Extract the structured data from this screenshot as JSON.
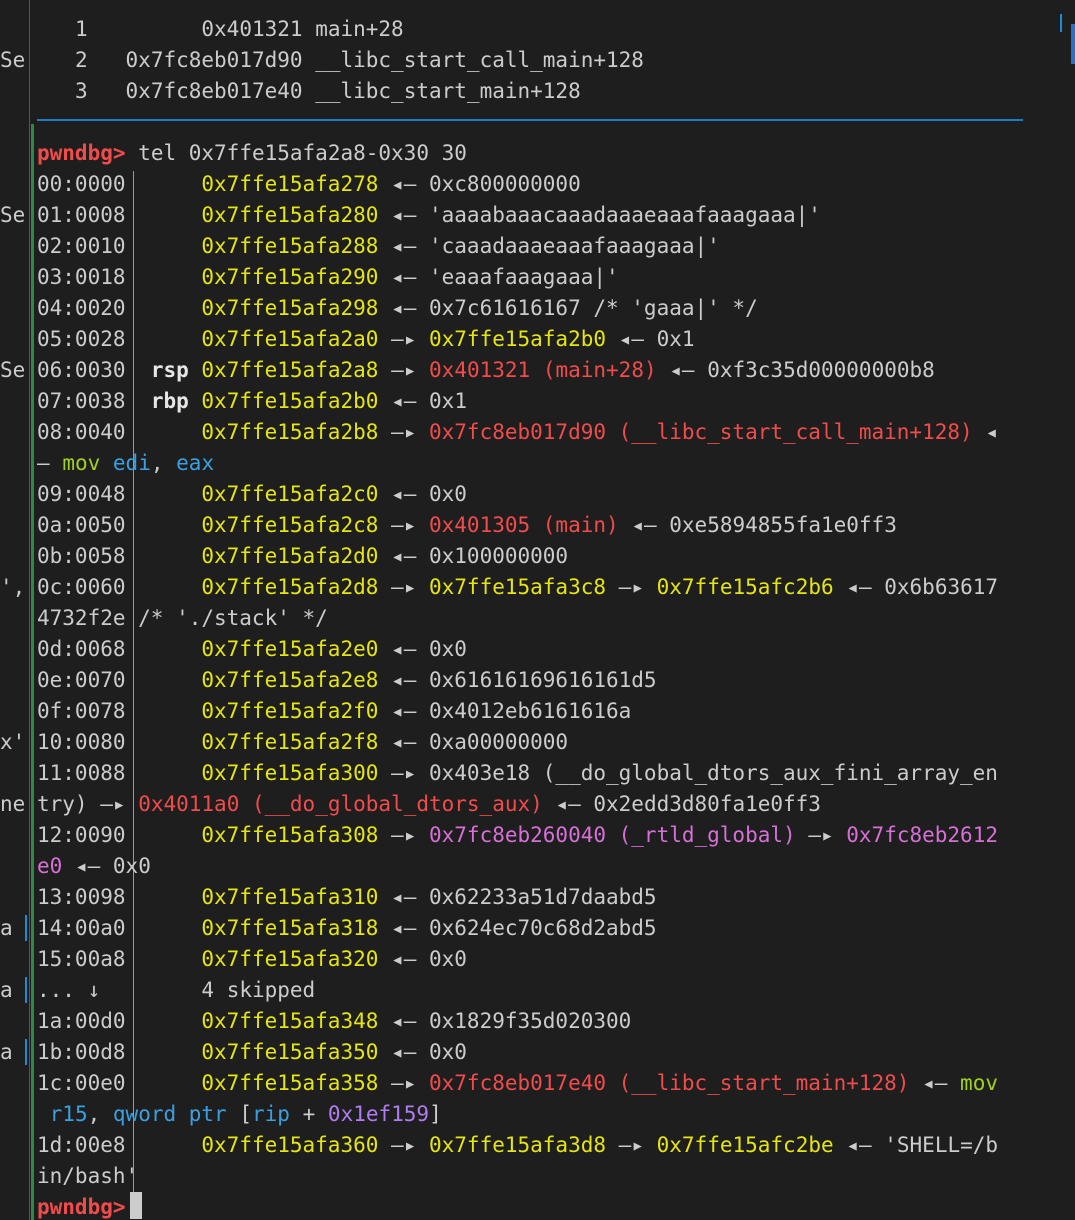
{
  "backtrace": [
    {
      "index": "1",
      "addr": "0x401321",
      "sym": "main+28"
    },
    {
      "index": "2",
      "addr": "0x7fc8eb017d90",
      "sym": "__libc_start_call_main+128"
    },
    {
      "index": "3",
      "addr": "0x7fc8eb017e40",
      "sym": "__libc_start_main+128"
    }
  ],
  "left_fragments": [
    "Se",
    "Se",
    "Se",
    "',",
    "x'",
    "ne",
    "a",
    "a",
    "a"
  ],
  "prompt": "pwndbg>",
  "command": "tel 0x7ffe15afa2a8-0x30 30",
  "arrows": {
    "left": "◂—",
    "right": "—▸",
    "skip_down": "↓"
  },
  "stack": {
    "r00": {
      "off": "00:0000",
      "addr": "0x7ffe15afa278",
      "val": "0xc800000000"
    },
    "r01": {
      "off": "01:0008",
      "addr": "0x7ffe15afa280",
      "val": "'aaaabaaacaaadaaaeaaafaaagaaa|'"
    },
    "r02": {
      "off": "02:0010",
      "addr": "0x7ffe15afa288",
      "val": "'caaadaaaeaaafaaagaaa|'"
    },
    "r03": {
      "off": "03:0018",
      "addr": "0x7ffe15afa290",
      "val": "'eaaafaaagaaa|'"
    },
    "r04": {
      "off": "04:0020",
      "addr": "0x7ffe15afa298",
      "val": "0x7c61616167 /* 'gaaa|' */"
    },
    "r05": {
      "off": "05:0028",
      "addr": "0x7ffe15afa2a0",
      "ptr": "0x7ffe15afa2b0",
      "val": "0x1"
    },
    "r06": {
      "off": "06:0030",
      "reg": "rsp",
      "addr": "0x7ffe15afa2a8",
      "ptr": "0x401321 (main+28)",
      "val": "0xf3c35d00000000b8"
    },
    "r07": {
      "off": "07:0038",
      "reg": "rbp",
      "addr": "0x7ffe15afa2b0",
      "val": "0x1"
    },
    "r08": {
      "off": "08:0040",
      "addr": "0x7ffe15afa2b8",
      "ptr": "0x7fc8eb017d90 (__libc_start_call_main+128)",
      "tail": "◂",
      "cont_dash": "—",
      "cont_op": "mov",
      "cont_a": "edi",
      "cont_comma": ",",
      "cont_b": "eax"
    },
    "r09": {
      "off": "09:0048",
      "addr": "0x7ffe15afa2c0",
      "val": "0x0"
    },
    "r0a": {
      "off": "0a:0050",
      "addr": "0x7ffe15afa2c8",
      "ptr": "0x401305 (main)",
      "val": "0xe5894855fa1e0ff3"
    },
    "r0b": {
      "off": "0b:0058",
      "addr": "0x7ffe15afa2d0",
      "val": "0x100000000"
    },
    "r0c": {
      "off": "0c:0060",
      "addr": "0x7ffe15afa2d8",
      "ptr1": "0x7ffe15afa3c8",
      "ptr2": "0x7ffe15afc2b6",
      "val": "0x6b63617",
      "cont": "4732f2e /* './stack' */"
    },
    "r0d": {
      "off": "0d:0068",
      "addr": "0x7ffe15afa2e0",
      "val": "0x0"
    },
    "r0e": {
      "off": "0e:0070",
      "addr": "0x7ffe15afa2e8",
      "val": "0x61616169616161d5"
    },
    "r0f": {
      "off": "0f:0078",
      "addr": "0x7ffe15afa2f0",
      "val": "0x4012eb6161616a"
    },
    "r10": {
      "off": "10:0080",
      "addr": "0x7ffe15afa2f8",
      "val": "0xa00000000"
    },
    "r11": {
      "off": "11:0088",
      "addr": "0x7ffe15afa300",
      "ptr": "0x403e18 (__do_global_dtors_aux_fini_array_en",
      "cont_a": "try)",
      "cont_ptr": "0x4011a0 (__do_global_dtors_aux)",
      "val": "0x2edd3d80fa1e0ff3"
    },
    "r12": {
      "off": "12:0090",
      "addr": "0x7ffe15afa308",
      "ptr1": "0x7fc8eb260040 (_rtld_global)",
      "ptr2": "0x7fc8eb2612",
      "cont_a": "e0",
      "val": "0x0"
    },
    "r13": {
      "off": "13:0098",
      "addr": "0x7ffe15afa310",
      "val": "0x62233a51d7daabd5"
    },
    "r14": {
      "off": "14:00a0",
      "addr": "0x7ffe15afa318",
      "val": "0x624ec70c68d2abd5"
    },
    "r15": {
      "off": "15:00a8",
      "addr": "0x7ffe15afa320",
      "val": "0x0"
    },
    "skip": {
      "dots": "...",
      "text": "4 skipped"
    },
    "r1a": {
      "off": "1a:00d0",
      "addr": "0x7ffe15afa348",
      "val": "0x1829f35d020300"
    },
    "r1b": {
      "off": "1b:00d8",
      "addr": "0x7ffe15afa350",
      "val": "0x0"
    },
    "r1c": {
      "off": "1c:00e0",
      "addr": "0x7ffe15afa358",
      "ptr": "0x7fc8eb017e40 (__libc_start_main+128)",
      "op": "mov",
      "cont_a": "r15",
      "cont_comma": ",",
      "cont_b": "qword ptr",
      "cont_lb": "[",
      "cont_reg": "rip",
      "cont_plus": "+",
      "cont_num": "0x1ef159",
      "cont_rb": "]"
    },
    "r1d": {
      "off": "1d:00e8",
      "addr": "0x7ffe15afa360",
      "ptr1": "0x7ffe15afa3d8",
      "ptr2": "0x7ffe15afc2be",
      "val": "'SHELL=/b",
      "cont": "in/bash'"
    }
  },
  "colors": {
    "background": "#1e1e1e",
    "prompt": "#f14c4c",
    "address": "#e5e510",
    "code_pointer": "#f14c4c",
    "data_pointer": "#d670d6",
    "instruction": "#a0d020",
    "register": "#3aa0e0",
    "immediate": "#b07cf0",
    "divider": "#1f7bc0",
    "gutter": "#2b8a45"
  }
}
